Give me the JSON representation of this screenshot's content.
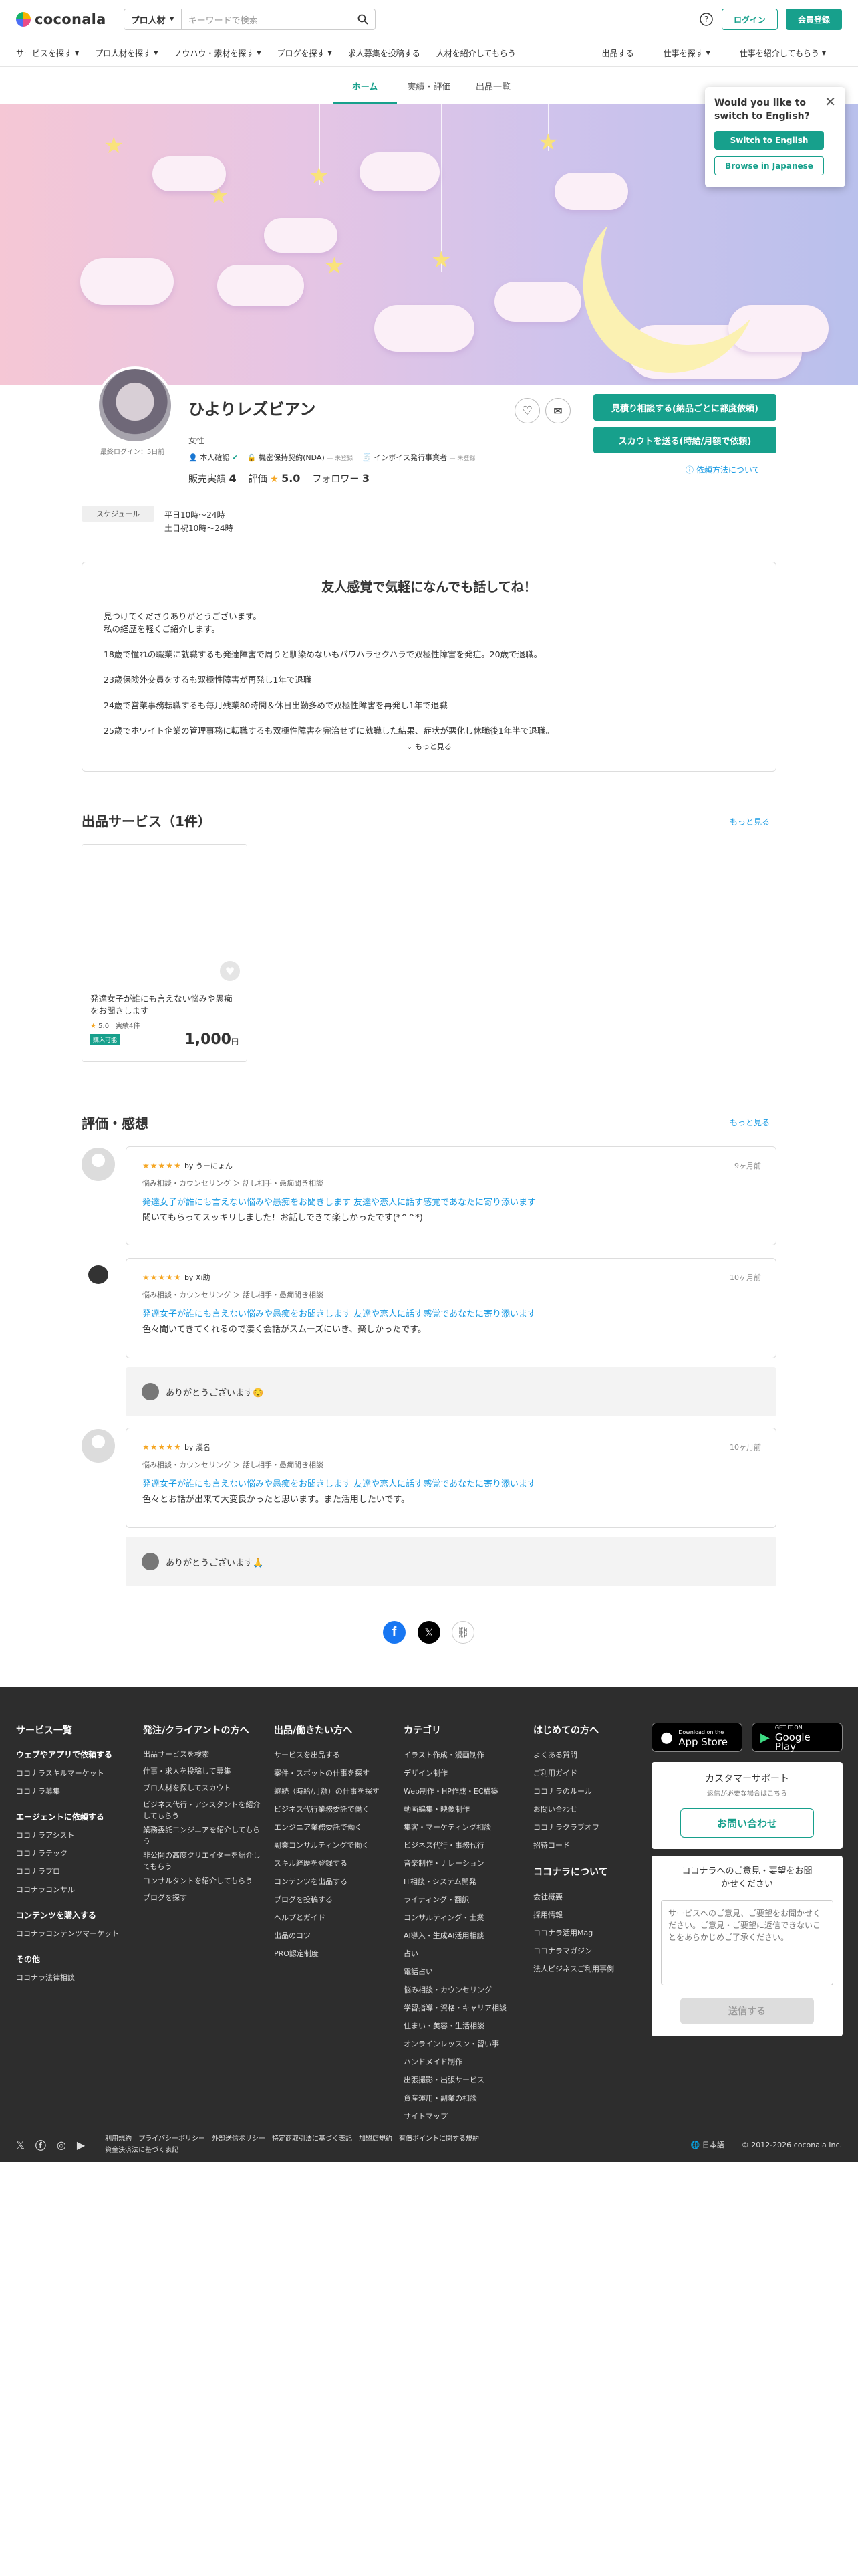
{
  "header": {
    "logo": "coconala",
    "category_select": "プロ人材",
    "search_placeholder": "キーワードで検索",
    "login": "ログイン",
    "signup": "会員登録"
  },
  "nav": {
    "items": [
      "サービスを探す",
      "プロ人材を探す",
      "ノウハウ・素材を探す",
      "ブログを探す",
      "求人募集を投稿する",
      "人材を紹介してもらう"
    ],
    "right": [
      "出品する",
      "仕事を探す",
      "仕事を紹介してもらう"
    ]
  },
  "tabs": [
    "ホーム",
    "実績・評価",
    "出品一覧"
  ],
  "popup": {
    "title": "Would you like to switch to English?",
    "english": "Switch to English",
    "japanese": "Browse in Japanese"
  },
  "profile": {
    "name": "ひよりレズビアン",
    "last_login": "最終ログイン：5日前",
    "gender": "女性",
    "badges": [
      "本人確認",
      "機密保持契約(NDA)",
      "インボイス発行事業者"
    ],
    "badge_status": "— 未登録",
    "sales_label": "販売実績",
    "sales": "4",
    "rating_label": "評価",
    "rating": "5.0",
    "followers_label": "フォロワー",
    "followers": "3",
    "quote_btn": "見積り相談する(納品ごとに都度依頼)",
    "scout_btn": "スカウトを送る(時給/月額で依頼)",
    "how_to": "依頼方法について",
    "schedule_label": "スケジュール",
    "schedule": [
      "平日10時〜24時",
      "土日祝10時〜24時"
    ]
  },
  "intro": {
    "title": "友人感覚で気軽になんでも話してね！",
    "lines": [
      "見つけてくださりありがとうございます。",
      "私の経歴を軽くご紹介します。",
      "",
      "18歳で憧れの職業に就職するも発達障害で周りと馴染めないもパワハラセクハラで双極性障害を発症。20歳で退職。",
      "",
      "23歳保険外交員をするも双極性障害が再発し1年で退職",
      "",
      "24歳で営業事務転職するも毎月残業80時間＆休日出勤多めで双極性障害を再発し1年で退職",
      "",
      "25歳でホワイト企業の管理事務に転職するも双極性障害を完治せずに就職した結果、症状が悪化し休職後1年半で退職。"
    ],
    "more": "もっと見る"
  },
  "services": {
    "title": "出品サービス（1件）",
    "more": "もっと見る",
    "card": {
      "title": "発達女子が誰にも言えない悩みや愚痴をお聞きします",
      "rating": "5.0",
      "count": "実績4件",
      "tag": "購入可能",
      "price": "1,000",
      "unit": "円"
    }
  },
  "reviews": {
    "title": "評価・感想",
    "more": "もっと見る",
    "items": [
      {
        "user": "by うーにょん",
        "date": "9ヶ月前",
        "cat": "悩み相談・カウンセリング ＞ 話し相手・愚痴聞き相談",
        "link": "発達女子が誰にも言えない悩みや愚痴をお聞きします 友達や恋人に話す感覚であなたに寄り添います",
        "text": "聞いてもらってスッキリしました！お話しできて楽しかったです(*^^*)"
      },
      {
        "user": "by Xi助",
        "date": "10ヶ月前",
        "cat": "悩み相談・カウンセリング ＞ 話し相手・愚痴聞き相談",
        "link": "発達女子が誰にも言えない悩みや愚痴をお聞きします 友達や恋人に話す感覚であなたに寄り添います",
        "text": "色々聞いてきてくれるので凄く会話がスムーズにいき、楽しかったです。",
        "reply": "ありがとうございます☺️"
      },
      {
        "user": "by 漢名",
        "date": "10ヶ月前",
        "cat": "悩み相談・カウンセリング ＞ 話し相手・愚痴聞き相談",
        "link": "発達女子が誰にも言えない悩みや愚痴をお聞きします 友達や恋人に話す感覚であなたに寄り添います",
        "text": "色々とお話が出来て大変良かったと思います。また活用したいです。",
        "reply": "ありがとうございます🙏"
      }
    ]
  },
  "footer": {
    "col1": {
      "title": "サービス一覧",
      "groups": [
        {
          "h": "ウェブやアプリで依頼する",
          "items": [
            "ココナラスキルマーケット",
            "ココナラ募集"
          ]
        },
        {
          "h": "エージェントに依頼する",
          "items": [
            "ココナラアシスト",
            "ココナラテック",
            "ココナラプロ",
            "ココナラコンサル"
          ]
        },
        {
          "h": "コンテンツを購入する",
          "items": [
            "ココナラコンテンツマーケット"
          ]
        },
        {
          "h": "その他",
          "items": [
            "ココナラ法律相談"
          ]
        }
      ]
    },
    "col2": {
      "title": "発注/クライアントの方へ",
      "items": [
        "出品サービスを検索",
        "仕事・求人を投稿して募集",
        "プロ人材を探してスカウト",
        "ビジネス代行・アシスタントを紹介してもらう",
        "業務委託エンジニアを紹介してもらう",
        "非公開の高度クリエイターを紹介してもらう",
        "コンサルタントを紹介してもらう",
        "ブログを探す"
      ]
    },
    "col3": {
      "title": "出品/働きたい方へ",
      "items": [
        "サービスを出品する",
        "案件・スポットの仕事を探す",
        "継続（時給/月額）の仕事を探す",
        "ビジネス代行業務委託で働く",
        "エンジニア業務委託で働く",
        "副業コンサルティングで働く",
        "スキル経歴を登録する",
        "コンテンツを出品する",
        "ブログを投稿する",
        "ヘルプとガイド",
        "出品のコツ",
        "PRO認定制度"
      ]
    },
    "col4": {
      "title": "カテゴリ",
      "items": [
        "イラスト作成・漫画制作",
        "デザイン制作",
        "Web制作・HP作成・EC構築",
        "動画編集・映像制作",
        "集客・マーケティング相談",
        "ビジネス代行・事務代行",
        "音楽制作・ナレーション",
        "IT相談・システム開発",
        "ライティング・翻訳",
        "コンサルティング・士業",
        "AI導入・生成AI活用相談",
        "占い",
        "電話占い",
        "悩み相談・カウンセリング",
        "学習指導・資格・キャリア相談",
        "住まい・美容・生活相談",
        "オンラインレッスン・習い事",
        "ハンドメイド制作",
        "出張撮影・出張サービス",
        "資産運用・副業の相談",
        "サイトマップ"
      ]
    },
    "col5": {
      "title": "はじめての方へ",
      "items": [
        "よくある質問",
        "ご利用ガイド",
        "ココナラのルール",
        "お問い合わせ",
        "ココナラクラブオフ",
        "招待コード"
      ],
      "h2": "ココナラについて",
      "items2": [
        "会社概要",
        "採用情報",
        "ココナラ活用Mag",
        "ココナラマガジン",
        "法人ビジネスご利用事例"
      ]
    },
    "app_store_small": "Download on the",
    "app_store": "App Store",
    "google_small": "GET IT ON",
    "google": "Google Play",
    "support_title": "カスタマーサポート",
    "support_sub": "返信が必要な場合はこちら",
    "contact": "お問い合わせ",
    "feedback_title": "ココナラへのご意見・要望をお聞かせください",
    "feedback_placeholder": "サービスへのご意見、ご要望をお聞かせください。ご意見・ご要望に返信できないことをあらかじめご了承ください。",
    "send": "送信する",
    "legal": [
      "利用規約",
      "プライバシーポリシー",
      "外部送信ポリシー",
      "特定商取引法に基づく表記",
      "加盟店規約",
      "有償ポイントに関する規約",
      "資金決済法に基づく表記"
    ],
    "language": "日本語",
    "copyright": "© 2012-2026 coconala Inc."
  }
}
